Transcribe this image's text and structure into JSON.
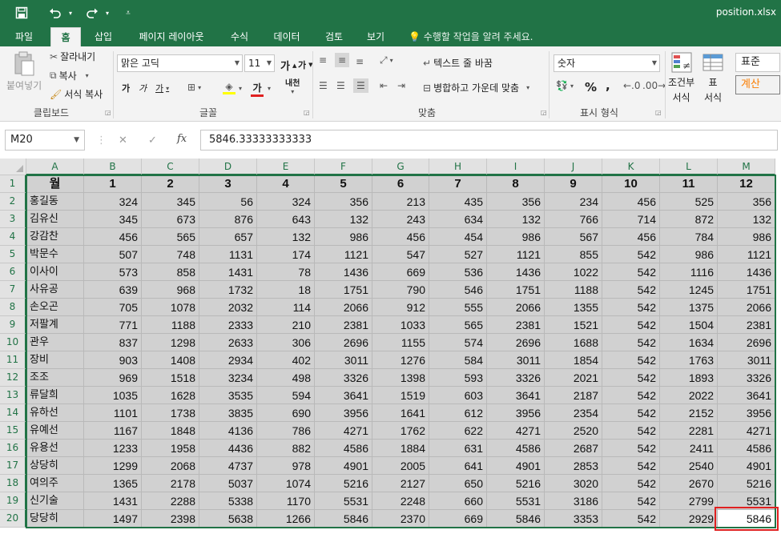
{
  "window": {
    "filename": "position.xlsx"
  },
  "quick_access": {
    "save_icon": "save-icon",
    "undo_icon": "undo-icon",
    "redo_icon": "redo-icon",
    "customize_icon": "customize-icon"
  },
  "tabs": [
    "파일",
    "홈",
    "삽입",
    "페이지 레이아웃",
    "수식",
    "데이터",
    "검토",
    "보기"
  ],
  "active_tab": "홈",
  "tell_me": "수행할 작업을 알려 주세요.",
  "ribbon": {
    "clipboard": {
      "paste": "붙여넣기",
      "cut": "잘라내기",
      "copy": "복사",
      "format_painter": "서식 복사",
      "label": "클립보드"
    },
    "font": {
      "name": "맑은 고딕",
      "size": "11",
      "grow": "가",
      "shrink": "가",
      "bold": "가",
      "italic": "가",
      "underline": "가",
      "color_a": "가",
      "phonetic": "내천",
      "label": "글꼴"
    },
    "alignment": {
      "wrap": "텍스트 줄 바꿈",
      "merge": "병합하고 가운데 맞춤",
      "label": "맞춤"
    },
    "number": {
      "format": "숫자",
      "percent": "%",
      "comma": ",",
      "label": "표시 형식"
    },
    "styles": {
      "conditional": "조건부",
      "conditional2": "서식",
      "table": "표",
      "table2": "서식",
      "normal": "표준",
      "calc": "계산"
    }
  },
  "formula_bar": {
    "name_box": "M20",
    "fx": "fx",
    "value": "5846.33333333333",
    "cancel": "✕",
    "enter": "✓"
  },
  "columns": [
    "A",
    "B",
    "C",
    "D",
    "E",
    "F",
    "G",
    "H",
    "I",
    "J",
    "K",
    "L",
    "M"
  ],
  "rows": [
    [
      "월",
      "1",
      "2",
      "3",
      "4",
      "5",
      "6",
      "7",
      "8",
      "9",
      "10",
      "11",
      "12"
    ],
    [
      "홍길동",
      "324",
      "345",
      "56",
      "324",
      "356",
      "213",
      "435",
      "356",
      "234",
      "456",
      "525",
      "356"
    ],
    [
      "김유신",
      "345",
      "673",
      "876",
      "643",
      "132",
      "243",
      "634",
      "132",
      "766",
      "714",
      "872",
      "132"
    ],
    [
      "강감찬",
      "456",
      "565",
      "657",
      "132",
      "986",
      "456",
      "454",
      "986",
      "567",
      "456",
      "784",
      "986"
    ],
    [
      "박문수",
      "507",
      "748",
      "1131",
      "174",
      "1121",
      "547",
      "527",
      "1121",
      "855",
      "542",
      "986",
      "1121"
    ],
    [
      "이사이",
      "573",
      "858",
      "1431",
      "78",
      "1436",
      "669",
      "536",
      "1436",
      "1022",
      "542",
      "1116",
      "1436"
    ],
    [
      "사유공",
      "639",
      "968",
      "1732",
      "18",
      "1751",
      "790",
      "546",
      "1751",
      "1188",
      "542",
      "1245",
      "1751"
    ],
    [
      "손오곤",
      "705",
      "1078",
      "2032",
      "114",
      "2066",
      "912",
      "555",
      "2066",
      "1355",
      "542",
      "1375",
      "2066"
    ],
    [
      "저팔계",
      "771",
      "1188",
      "2333",
      "210",
      "2381",
      "1033",
      "565",
      "2381",
      "1521",
      "542",
      "1504",
      "2381"
    ],
    [
      "관우",
      "837",
      "1298",
      "2633",
      "306",
      "2696",
      "1155",
      "574",
      "2696",
      "1688",
      "542",
      "1634",
      "2696"
    ],
    [
      "장비",
      "903",
      "1408",
      "2934",
      "402",
      "3011",
      "1276",
      "584",
      "3011",
      "1854",
      "542",
      "1763",
      "3011"
    ],
    [
      "조조",
      "969",
      "1518",
      "3234",
      "498",
      "3326",
      "1398",
      "593",
      "3326",
      "2021",
      "542",
      "1893",
      "3326"
    ],
    [
      "류달희",
      "1035",
      "1628",
      "3535",
      "594",
      "3641",
      "1519",
      "603",
      "3641",
      "2187",
      "542",
      "2022",
      "3641"
    ],
    [
      "유하선",
      "1101",
      "1738",
      "3835",
      "690",
      "3956",
      "1641",
      "612",
      "3956",
      "2354",
      "542",
      "2152",
      "3956"
    ],
    [
      "유예선",
      "1167",
      "1848",
      "4136",
      "786",
      "4271",
      "1762",
      "622",
      "4271",
      "2520",
      "542",
      "2281",
      "4271"
    ],
    [
      "유용선",
      "1233",
      "1958",
      "4436",
      "882",
      "4586",
      "1884",
      "631",
      "4586",
      "2687",
      "542",
      "2411",
      "4586"
    ],
    [
      "상당히",
      "1299",
      "2068",
      "4737",
      "978",
      "4901",
      "2005",
      "641",
      "4901",
      "2853",
      "542",
      "2540",
      "4901"
    ],
    [
      "여의주",
      "1365",
      "2178",
      "5037",
      "1074",
      "5216",
      "2127",
      "650",
      "5216",
      "3020",
      "542",
      "2670",
      "5216"
    ],
    [
      "신기술",
      "1431",
      "2288",
      "5338",
      "1170",
      "5531",
      "2248",
      "660",
      "5531",
      "3186",
      "542",
      "2799",
      "5531"
    ],
    [
      "당당히",
      "1497",
      "2398",
      "5638",
      "1266",
      "5846",
      "2370",
      "669",
      "5846",
      "3353",
      "542",
      "2929",
      "5846"
    ]
  ],
  "accent_color": "#217346"
}
